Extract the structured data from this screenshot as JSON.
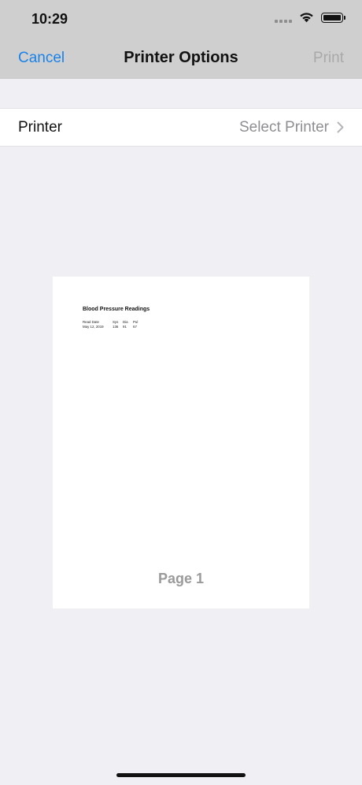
{
  "status_bar": {
    "time": "10:29"
  },
  "nav": {
    "cancel_label": "Cancel",
    "title": "Printer Options",
    "print_label": "Print"
  },
  "printer_row": {
    "label": "Printer",
    "value": "Select Printer"
  },
  "preview": {
    "doc_title": "Blood Pressure Readings",
    "table_headers": [
      "Read Date",
      "Sys",
      "Dia",
      "Pul"
    ],
    "table_rows": [
      [
        "May 12, 2019",
        "136",
        "91",
        "67"
      ]
    ],
    "page_label": "Page 1"
  },
  "colors": {
    "accent": "#1a82e8",
    "nav_background": "#cfcfcf",
    "screen_background": "#efeff4",
    "disabled_text": "#a9a9a9"
  }
}
